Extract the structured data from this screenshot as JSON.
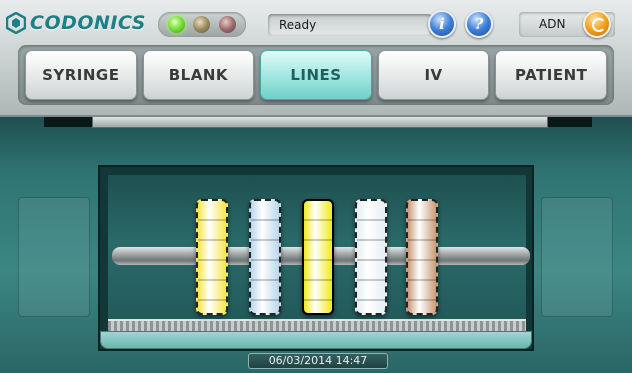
{
  "brand": {
    "name": "CODONICS",
    "color": "#1f7f86"
  },
  "indicators": [
    {
      "name": "green-status-light",
      "color": "#7be23a"
    },
    {
      "name": "amber-status-light",
      "color": "#9b8c5e"
    },
    {
      "name": "red-status-light",
      "color": "#9d6c6c"
    }
  ],
  "status": {
    "text": "Ready"
  },
  "header": {
    "info_icon_label": "i",
    "help_icon_label": "?",
    "user_label": "ADN"
  },
  "tabs": [
    {
      "label": "SYRINGE",
      "active": false
    },
    {
      "label": "BLANK",
      "active": false
    },
    {
      "label": "LINES",
      "active": true
    },
    {
      "label": "IV",
      "active": false
    },
    {
      "label": "PATIENT",
      "active": false
    }
  ],
  "label_rolls": [
    {
      "name": "epidural-roll",
      "color": "#f4e64a"
    },
    {
      "name": "arterial-roll",
      "color": "#b9d7ec"
    },
    {
      "name": "intrathecal-roll",
      "color": "#f2ea18"
    },
    {
      "name": "central-venous-roll",
      "color": "#e7eef3"
    },
    {
      "name": "brown-roll",
      "color": "#c99a78"
    }
  ],
  "datetime": "06/03/2014 14:47",
  "colors": {
    "panel_teal": "#3b8683",
    "active_tab": "#9fe6e0"
  }
}
